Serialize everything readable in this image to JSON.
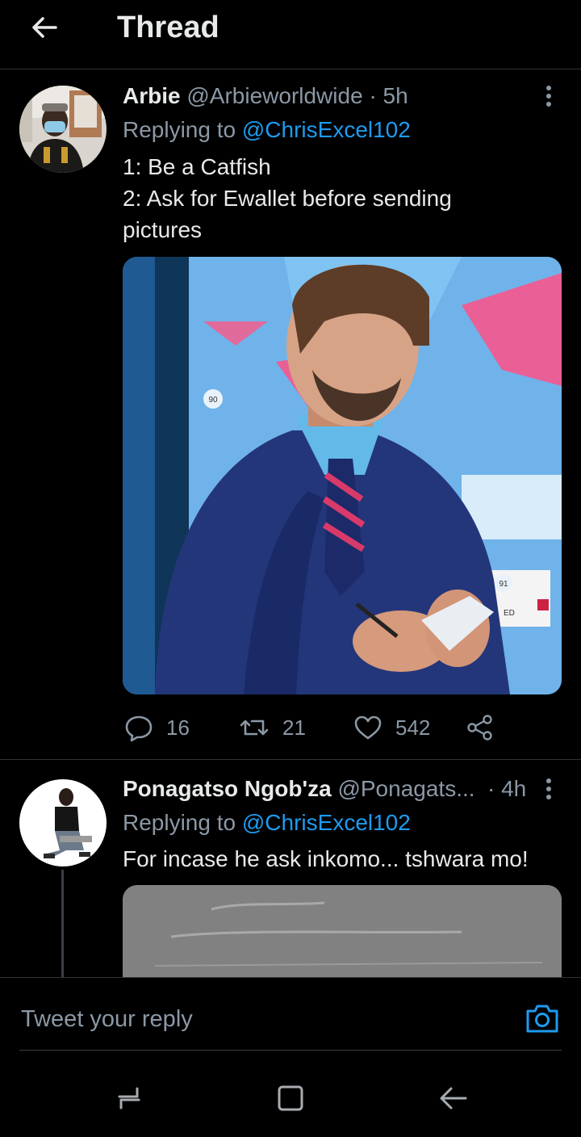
{
  "header": {
    "back_icon": "arrow-left-icon",
    "title": "Thread"
  },
  "tweets": [
    {
      "display_name": "Arbie",
      "handle": "@Arbieworldwide",
      "separator": "·",
      "time": "5h",
      "replying_prefix": "Replying to",
      "replying_to": "@ChrisExcel102",
      "text_lines": [
        "1: Be a Catfish",
        "2: Ask for Ewallet before sending",
        "pictures"
      ],
      "media": {
        "overlay_labels": [
          "90",
          "91",
          "ED"
        ]
      },
      "actions": {
        "replies": "16",
        "retweets": "21",
        "likes": "542"
      }
    },
    {
      "display_name": "Ponagatso Ngob'za",
      "handle": "@Ponagats...",
      "separator": "·",
      "time": "4h",
      "replying_prefix": "Replying to",
      "replying_to": "@ChrisExcel102",
      "text_lines": [
        "For incase he ask inkomo... tshwara mo!"
      ]
    }
  ],
  "reply_bar": {
    "placeholder": "Tweet your reply",
    "camera_icon": "camera-icon"
  },
  "navbar": {
    "icons": [
      "recent-apps-icon",
      "home-icon",
      "back-icon"
    ]
  },
  "colors": {
    "background": "#000000",
    "accent": "#1d9bf0",
    "secondary_text": "#8b98a5",
    "divider": "#2f3336"
  }
}
